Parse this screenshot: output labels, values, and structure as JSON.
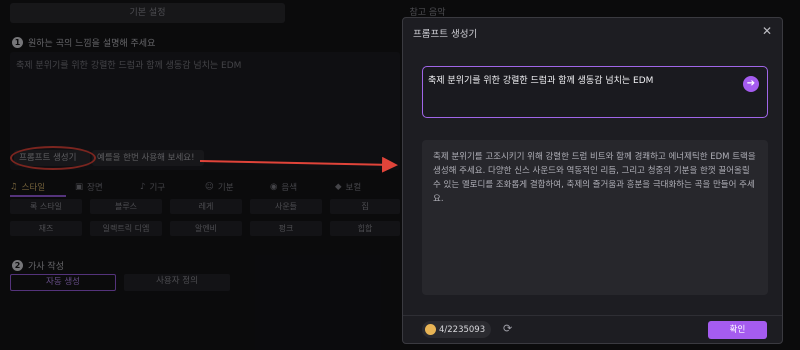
{
  "background": {
    "top_tabs": [
      "기본 설정",
      "참고 음악"
    ],
    "step1": {
      "num": "1",
      "title": "원하는 곡의 느낌을 설명해 주세요"
    },
    "description": "축제 분위기를 위한 강렬한 드럼과 함께 생동감 넘치는 EDM",
    "prompt_generator_btn": "프롬프트 생성기",
    "random_btn": "예를을 한번 사용해 보세요!",
    "categories": [
      {
        "icon": "♫",
        "label": "스타일",
        "active": true
      },
      {
        "icon": "▣",
        "label": "장면"
      },
      {
        "icon": "♪",
        "label": "기구"
      },
      {
        "icon": "☺",
        "label": "기분"
      },
      {
        "icon": "◉",
        "label": "음색"
      },
      {
        "icon": "◆",
        "label": "보컬"
      }
    ],
    "style_chips_row1": [
      "록 스타일",
      "블루스",
      "레게",
      "사운들",
      "집"
    ],
    "style_chips_row2": [
      "재즈",
      "일렉트릭 디엠",
      "알엔비",
      "펑크",
      "힙합"
    ],
    "step2": {
      "num": "2",
      "title": "가사 작성"
    },
    "lyrics_modes": [
      "자동 생성",
      "사용자 정의"
    ]
  },
  "modal": {
    "title": "프롬프트 생성기",
    "close": "✕",
    "prompt_input": "축제 분위기를 위한 강렬한 드럼과 함께 생동감 넘치는 EDM",
    "send": "➔",
    "result": "축제 분위기를 고조시키기 위해 강렬한 드럼 비트와 함께 경쾌하고 에너제틱한 EDM 트랙을 생성해 주세요. 다양한 신스 사운드와 역동적인 리듬, 그리고 청중의 기분을 한껏 끌어올릴 수 있는 멜로디를 조화롭게 결합하여, 축제의 즐거움과 흥분을 극대화하는 곡을 만들어 주세요.",
    "coins": "4/2235093",
    "refresh": "⟳",
    "confirm": "확인"
  },
  "colors": {
    "accent": "#a55cf0",
    "annotation": "#e0443a"
  }
}
